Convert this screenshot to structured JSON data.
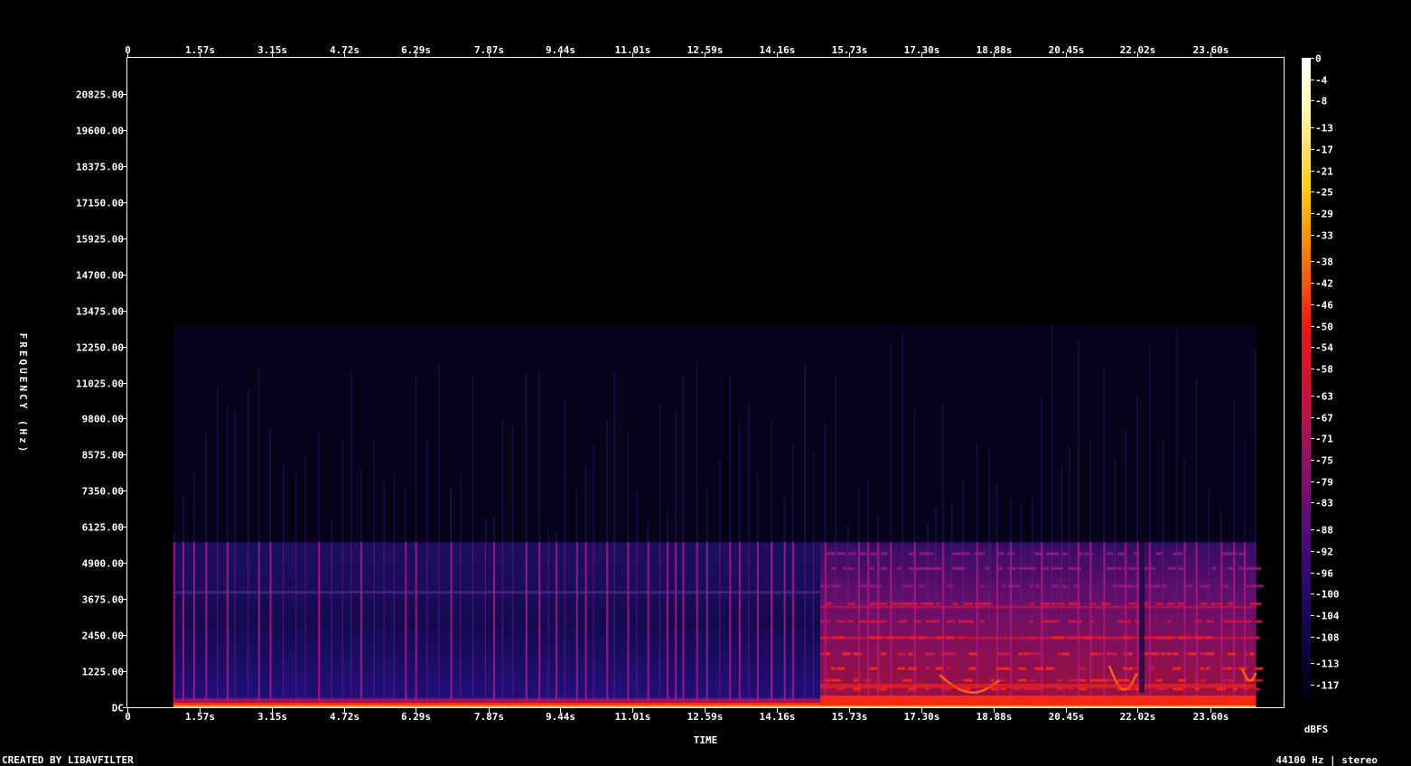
{
  "footer": {
    "left_label": "CREATED BY LIBAVFILTER",
    "right_label": "44100 Hz | stereo"
  },
  "chart_data": {
    "type": "heatmap",
    "subtype": "spectrogram",
    "xlabel": "TIME",
    "ylabel": "FREQUENCY (Hz)",
    "x_unit": "s",
    "y_unit": "Hz",
    "xlim": [
      0,
      25.2
    ],
    "ylim": [
      0,
      22050
    ],
    "x_ticks": [
      0,
      1.57,
      3.15,
      4.72,
      6.29,
      7.87,
      9.44,
      11.01,
      12.59,
      14.16,
      15.73,
      17.3,
      18.88,
      20.45,
      22.02,
      23.6
    ],
    "x_tick_labels": [
      "0",
      "1.57s",
      "3.15s",
      "4.72s",
      "6.29s",
      "7.87s",
      "9.44s",
      "11.01s",
      "12.59s",
      "14.16s",
      "15.73s",
      "17.30s",
      "18.88s",
      "20.45s",
      "22.02s",
      "23.60s"
    ],
    "y_ticks": [
      0,
      1225,
      2450,
      3675,
      4900,
      6125,
      7350,
      8575,
      9800,
      11025,
      12250,
      13475,
      14700,
      15925,
      17150,
      18375,
      19600,
      20825
    ],
    "y_tick_labels": [
      "DC",
      "1225.00",
      "2450.00",
      "3675.00",
      "4900.00",
      "6125.00",
      "7350.00",
      "8575.00",
      "9800.00",
      "11025.00",
      "12250.00",
      "13475.00",
      "14700.00",
      "15925.00",
      "17150.00",
      "18375.00",
      "19600.00",
      "20825.00"
    ],
    "colorbar": {
      "label": "dBFS",
      "ticks": [
        0,
        -4,
        -8,
        -13,
        -17,
        -21,
        -25,
        -29,
        -33,
        -38,
        -42,
        -46,
        -50,
        -54,
        -58,
        -63,
        -67,
        -71,
        -75,
        -79,
        -83,
        -88,
        -92,
        -96,
        -100,
        -104,
        -108,
        -113,
        -117
      ],
      "range": [
        -120,
        0
      ],
      "colormap": "intensity (black → navy → purple → magenta → red → orange → yellow → white)"
    },
    "spectral_content": {
      "signal_start_s": 1.0,
      "signal_end_s": 24.6,
      "section_a": {
        "start_s": 1.0,
        "end_s": 15.1,
        "level_dbfs": -104,
        "upper_cutoff_hz": 5600,
        "bass_band_hz": [
          0,
          150
        ],
        "bass_level_dbfs": -42
      },
      "section_b": {
        "start_s": 15.1,
        "end_s": 24.6,
        "level_dbfs": -92,
        "upper_cutoff_hz": 5600,
        "bass_band_hz": [
          0,
          400
        ],
        "bass_level_dbfs": -46
      }
    }
  }
}
